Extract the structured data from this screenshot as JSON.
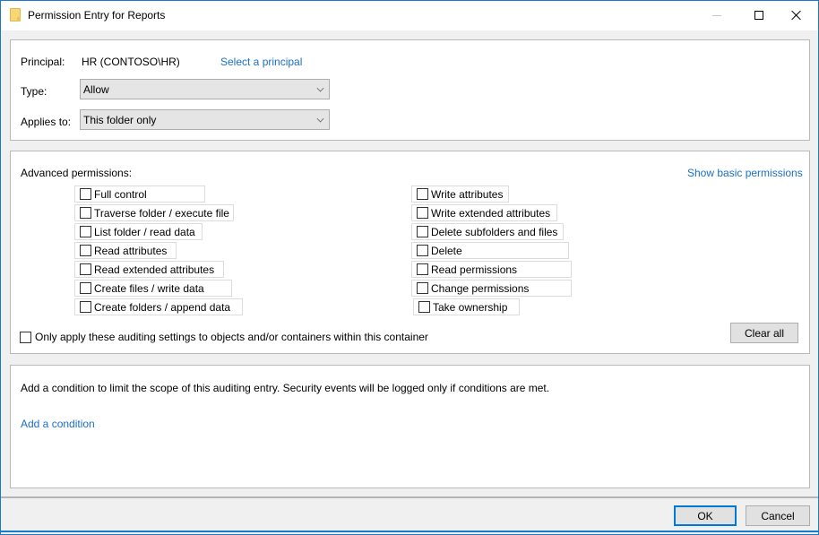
{
  "window": {
    "title": "Permission Entry for Reports",
    "icon": "folder-icon",
    "controls": [
      "minimize-icon",
      "maximize-icon",
      "close-icon"
    ]
  },
  "principal": {
    "label": "Principal:",
    "value": "HR (CONTOSO\\HR)",
    "select_link": "Select a principal"
  },
  "type": {
    "label": "Type:",
    "value": "Allow"
  },
  "applies_to": {
    "label": "Applies to:",
    "value": "This folder only"
  },
  "advanced": {
    "label": "Advanced permissions:",
    "show_basic_link": "Show basic permissions",
    "left": [
      {
        "label": "Full control",
        "checked": false
      },
      {
        "label": "Traverse folder / execute file",
        "checked": false
      },
      {
        "label": "List folder / read data",
        "checked": false
      },
      {
        "label": "Read attributes",
        "checked": false
      },
      {
        "label": "Read extended attributes",
        "checked": false
      },
      {
        "label": "Create files / write data",
        "checked": false
      },
      {
        "label": "Create folders / append data",
        "checked": false
      }
    ],
    "right": [
      {
        "label": "Write attributes",
        "checked": false
      },
      {
        "label": "Write extended attributes",
        "checked": false
      },
      {
        "label": "Delete subfolders and files",
        "checked": false
      },
      {
        "label": "Delete",
        "checked": false
      },
      {
        "label": "Read permissions",
        "checked": false
      },
      {
        "label": "Change permissions",
        "checked": false
      },
      {
        "label": "Take ownership",
        "checked": false
      }
    ],
    "only_apply": {
      "label": "Only apply these auditing settings to objects and/or containers within this container",
      "checked": false
    },
    "clear_all": "Clear all"
  },
  "condition": {
    "description": "Add a condition to limit the scope of this auditing entry. Security events will be logged only if conditions are met.",
    "add_link": "Add a condition"
  },
  "footer": {
    "ok": "OK",
    "cancel": "Cancel"
  }
}
